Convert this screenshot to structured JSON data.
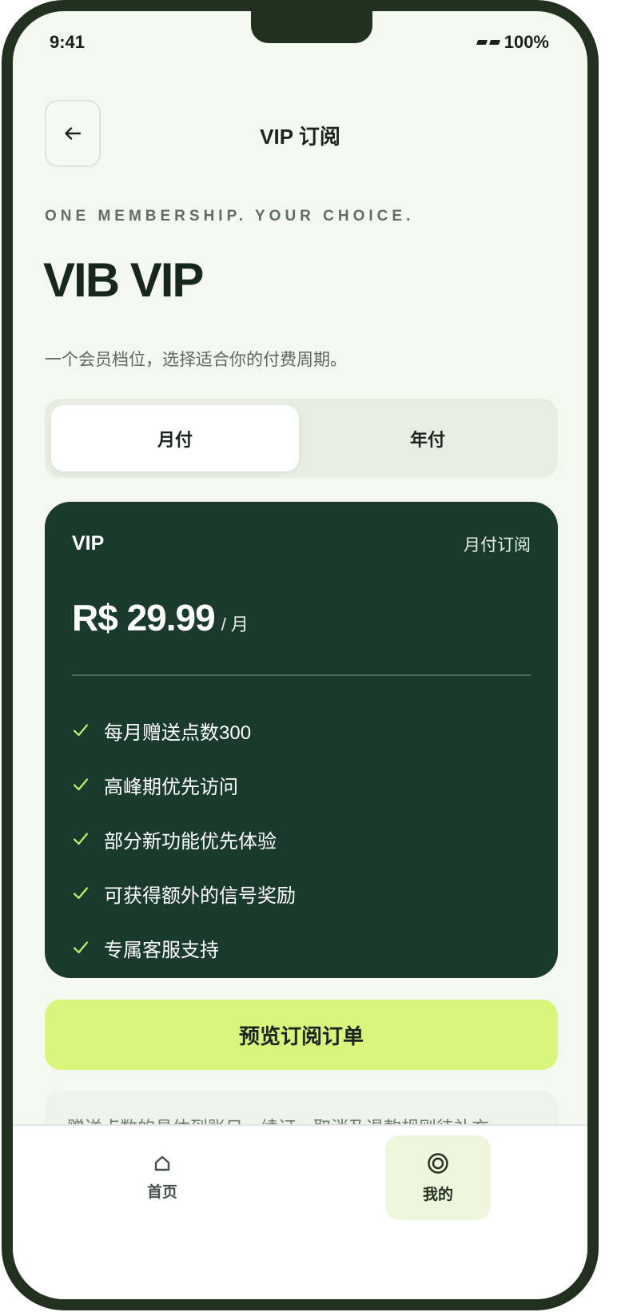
{
  "status_bar": {
    "time": "9:41",
    "battery": "100%"
  },
  "header": {
    "title": "VIP 订阅"
  },
  "hero": {
    "eyebrow": "ONE MEMBERSHIP. YOUR CHOICE.",
    "title": "VIB VIP",
    "subtitle": "一个会员档位，选择适合你的付费周期。"
  },
  "billing_toggle": {
    "options": [
      {
        "label": "月付",
        "selected": true
      },
      {
        "label": "年付",
        "selected": false
      }
    ]
  },
  "plan_card": {
    "name": "VIP",
    "period_label": "月付订阅",
    "price": "R$ 29.99",
    "price_unit": "/ 月",
    "features": [
      "每月赠送点数300",
      "高峰期优先访问",
      "部分新功能优先体验",
      "可获得额外的信号奖励",
      "专属客服支持"
    ]
  },
  "cta": {
    "label": "预览订阅订单"
  },
  "notice": {
    "text": "赠送点数的具体到账日、续订、取消及退款规则待补充。"
  },
  "tab_bar": {
    "items": [
      {
        "label": "首页",
        "icon": "home-icon",
        "active": false
      },
      {
        "label": "我的",
        "icon": "profile-ring-icon",
        "active": true
      }
    ]
  },
  "colors": {
    "card_bg": "#1b3a2e",
    "accent_lime": "#d8f57c",
    "check_green": "#c9f06a",
    "page_bg": "#f5f8f1"
  }
}
